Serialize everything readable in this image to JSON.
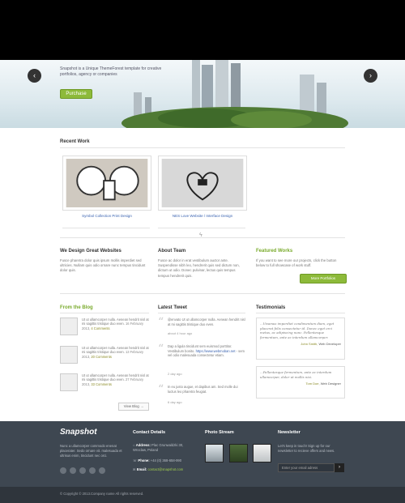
{
  "hero": {
    "tagline": "Snapshot is a Unique ThemeForest template for creative portfolios, agency or companies",
    "purchase_label": "Purchase",
    "prev_label": "‹",
    "next_label": "›"
  },
  "recent_work": {
    "title": "Recent Work",
    "items": [
      {
        "caption": "Symbol Collection Print Design"
      },
      {
        "caption": "NES Love Website / Interface Design"
      }
    ]
  },
  "columns": {
    "we_design": {
      "title": "We Design Great Websites",
      "text": "Fusce pharetra dolor quis ipsum mollis imperdiet sed ultricies. Nullam quis odio ornare nunc tempus tincidunt dolor quis."
    },
    "about": {
      "title": "About Team",
      "text": "Fusce ac dolor in erat vestibulum auctor ante. Suspendisse nibh leo, hendrerit quis sed dictum non, dictum ut odio. Donec pulvinar, lectus quis tempus tempus hendrerit quis."
    },
    "featured": {
      "title": "Featured Works",
      "text": "If you want to see more our projects, click the button below to full showcase of work stuff.",
      "button_label": "More Portfolios"
    }
  },
  "blog": {
    "title": "From the Blog",
    "items": [
      {
        "text": "Ut ut ullamcorper nulla. Aenean hendrit nisl at mi sagittis tristique duo even.",
        "date": "16 February 2013,",
        "comments": "4 Comments"
      },
      {
        "text": "Ut ut ullamcorper nulla. Aenean hendrit nisl at mi sagittis tristique duo even.",
        "date": "13 February 2013,",
        "comments": "20 Comments"
      },
      {
        "text": "Ut ut ullamcorper nulla. Aenean hendrit nisl at mi sagittis tristique duo even.",
        "date": "27 February 2013,",
        "comments": "33 Comments"
      }
    ],
    "view_label": "View Blog →"
  },
  "tweets": {
    "title": "Latest Tweet",
    "items": [
      {
        "text": "@envato Ut ut ullamcorper nulla. Aenean hendrit nisl at mi sagittis tristique duo even.",
        "ago": "about 4 hour ago"
      },
      {
        "text": "Dap a ligula tincidunt sem euismod porttitor. Vestibulum bonito.",
        "link": "https://www.webmoban.net",
        "text2": " - sem vel odio malesuada consectetur etiam.",
        "ago": "2 day ago"
      },
      {
        "text": "In eu justo augue, et dapibus am. Sed molle dui luctus leo pharetra feugiat.",
        "ago": "6 day ago"
      }
    ]
  },
  "testimonials": {
    "title": "Testimonials",
    "items": [
      {
        "text": "...Vivamus imperdiet condimentum diam, eget placerat felis consectetur id. Donec eget orci metus, ac adipiscing nunc. Pellentesque fermentum, ante ac interdum ullamcorper.",
        "name": "John Smith,",
        "role": "Web Developer"
      },
      {
        "text": "...Pellentesque fermentum, ante ac interdum ullamcorper, dolor ut mollis nisi.",
        "name": "Tom Doe,",
        "role": "Web Designer"
      }
    ]
  },
  "footer": {
    "logo": "Snapshot",
    "about_text": "Nunc a ullamcorper commodo enenat placerater. Sedo ornare vit. malesuada et ultrisus enim, tincidunt nec orci.",
    "contact_title": "Contact Details",
    "address_label": "Address:",
    "address": "Plac Grunwaldzki 30, Wroclaw, Poland",
    "phone_label": "Phone:",
    "phone": "+44 (0) 368-658-990",
    "email_label": "Email:",
    "email": "contact@snapshot.com",
    "photo_title": "Photo Stream",
    "newsletter_title": "Newsletter",
    "newsletter_text": "Let's keep in touch! Sign up for our newsletter to recieve offers and news.",
    "newsletter_placeholder": "Enter your email adress",
    "newsletter_btn": "›",
    "copyright": "© Copyright © 2013.Company name All rights reserved."
  },
  "colors": {
    "accent": "#8dba3a",
    "footer": "#3e4751"
  }
}
